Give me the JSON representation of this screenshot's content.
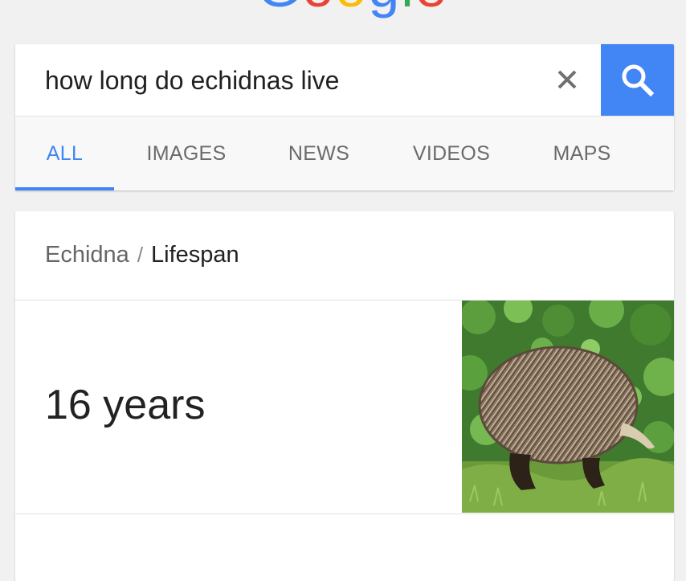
{
  "logo": {
    "letters": [
      {
        "char": "G",
        "color": "#4285f4"
      },
      {
        "char": "o",
        "color": "#ea4335"
      },
      {
        "char": "o",
        "color": "#fbbc05"
      },
      {
        "char": "g",
        "color": "#4285f4"
      },
      {
        "char": "l",
        "color": "#34a853"
      },
      {
        "char": "e",
        "color": "#ea4335"
      }
    ]
  },
  "search": {
    "query": "how long do echidnas live",
    "clear_icon": "close-icon",
    "search_icon": "search-icon",
    "accent_color": "#4285f4"
  },
  "tabs": [
    {
      "label": "ALL",
      "active": true
    },
    {
      "label": "IMAGES",
      "active": false
    },
    {
      "label": "NEWS",
      "active": false
    },
    {
      "label": "VIDEOS",
      "active": false
    },
    {
      "label": "MAPS",
      "active": false
    }
  ],
  "answer": {
    "breadcrumb_parent": "Echidna",
    "breadcrumb_separator": "/",
    "breadcrumb_current": "Lifespan",
    "value": "16 years",
    "image_subject": "echidna"
  }
}
